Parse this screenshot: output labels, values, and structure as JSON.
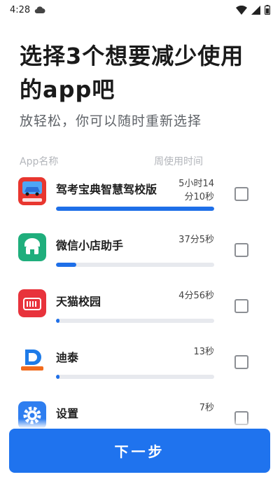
{
  "status_bar": {
    "time": "4:28"
  },
  "header": {
    "title": "选择3个想要减少使用的app吧",
    "subtitle": "放轻松，你可以随时重新选择"
  },
  "columns": {
    "app_name": "App名称",
    "weekly_time": "周使用时间"
  },
  "apps": [
    {
      "name": "驾考宝典智慧驾校版",
      "time_line1": "5小时14",
      "time_line2": "分10秒",
      "usage_fraction": 1.0,
      "icon": "car-icon",
      "checked": false
    },
    {
      "name": "微信小店助手",
      "time_line1": "37分5秒",
      "time_line2": "",
      "usage_fraction": 0.13,
      "icon": "shop-icon",
      "checked": false
    },
    {
      "name": "天猫校园",
      "time_line1": "4分56秒",
      "time_line2": "",
      "usage_fraction": 0.02,
      "icon": "tmall-icon",
      "checked": false
    },
    {
      "name": "迪泰",
      "time_line1": "13秒",
      "time_line2": "",
      "usage_fraction": 0.01,
      "icon": "d-logo-icon",
      "checked": false
    },
    {
      "name": "设置",
      "time_line1": "7秒",
      "time_line2": "",
      "usage_fraction": 0.005,
      "icon": "gear-icon",
      "checked": false
    }
  ],
  "footer": {
    "next_label": "下一步"
  },
  "colors": {
    "accent": "#1f73ee",
    "track": "#e7e9ee"
  }
}
